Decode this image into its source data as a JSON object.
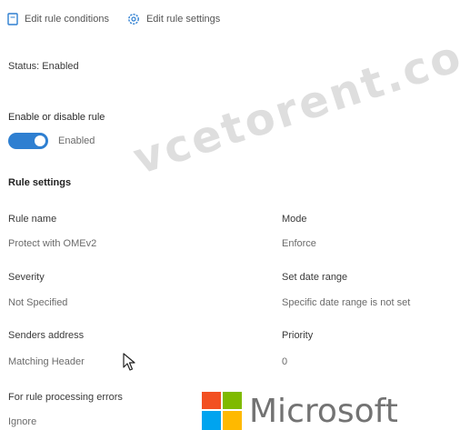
{
  "toolbar": {
    "edit_conditions_label": "Edit rule conditions",
    "edit_settings_label": "Edit rule settings"
  },
  "status": {
    "text": "Status: Enabled"
  },
  "enable_rule": {
    "heading": "Enable or disable rule",
    "toggle_on": true,
    "toggle_state_label": "Enabled",
    "accent_color": "#2e7fd1"
  },
  "rule_settings": {
    "heading": "Rule settings",
    "fields": {
      "rule_name": {
        "label": "Rule name",
        "value": "Protect with OMEv2"
      },
      "mode": {
        "label": "Mode",
        "value": "Enforce"
      },
      "severity": {
        "label": "Severity",
        "value": "Not Specified"
      },
      "date_range": {
        "label": "Set date range",
        "value": "Specific date range is not set"
      },
      "senders_address": {
        "label": "Senders address",
        "value": "Matching Header"
      },
      "priority": {
        "label": "Priority",
        "value": "0"
      },
      "processing_errors": {
        "label": "For rule processing errors",
        "value": "Ignore"
      }
    }
  },
  "watermark": {
    "text": "vcetorent.com"
  },
  "brand": {
    "text": "Microsoft"
  }
}
